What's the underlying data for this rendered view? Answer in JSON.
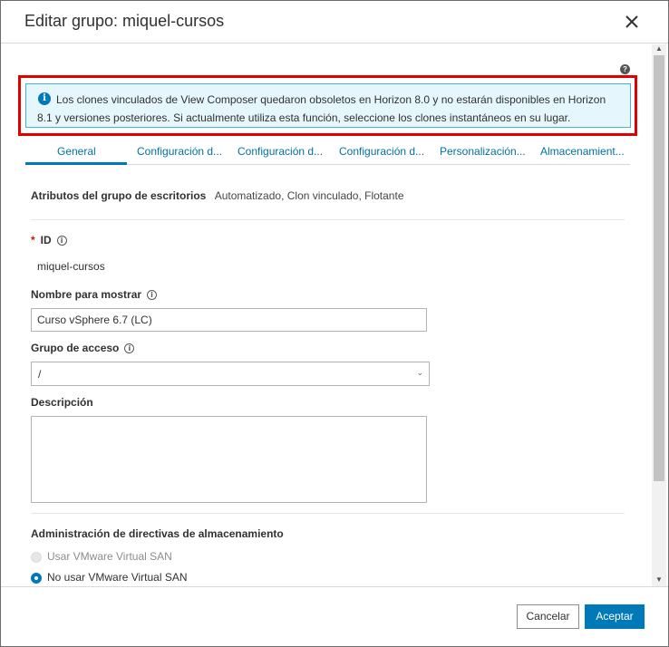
{
  "dialog": {
    "title": "Editar grupo: miquel-cursos",
    "help_glyph": "?",
    "alert": {
      "icon_glyph": "i",
      "text": "Los clones vinculados de View Composer quedaron obsoletos en Horizon 8.0 y no estarán disponibles en Horizon 8.1 y versiones posteriores. Si actualmente utiliza esta función, seleccione los clones instantáneos en su lugar."
    },
    "tabs": [
      {
        "label": "General",
        "active": true
      },
      {
        "label": "Configuración d...",
        "active": false
      },
      {
        "label": "Configuración d...",
        "active": false
      },
      {
        "label": "Configuración d...",
        "active": false
      },
      {
        "label": "Personalización...",
        "active": false
      },
      {
        "label": "Almacenamient...",
        "active": false
      }
    ],
    "attributes": {
      "label": "Atributos del grupo de escritorios",
      "value": "Automatizado, Clon vinculado, Flotante"
    },
    "fields": {
      "id": {
        "required_mark": "*",
        "label": "ID",
        "info_glyph": "i",
        "value": "miquel-cursos"
      },
      "display_name": {
        "label": "Nombre para mostrar",
        "info_glyph": "i",
        "value": "Curso vSphere 6.7 (LC)"
      },
      "access_group": {
        "label": "Grupo de acceso",
        "info_glyph": "i",
        "value": "/",
        "chevron": "⌄"
      },
      "description": {
        "label": "Descripción",
        "value": ""
      }
    },
    "storage_policy": {
      "label": "Administración de directivas de almacenamiento",
      "options": [
        {
          "label": "Usar VMware Virtual SAN",
          "checked": false,
          "disabled": true
        },
        {
          "label": "No usar VMware Virtual SAN",
          "checked": true,
          "disabled": false
        }
      ]
    },
    "buttons": {
      "cancel": "Cancelar",
      "accept": "Aceptar"
    },
    "colors": {
      "accent": "#0079b8",
      "highlight_border": "#e00000",
      "alert_bg": "#e5f7fd"
    }
  }
}
